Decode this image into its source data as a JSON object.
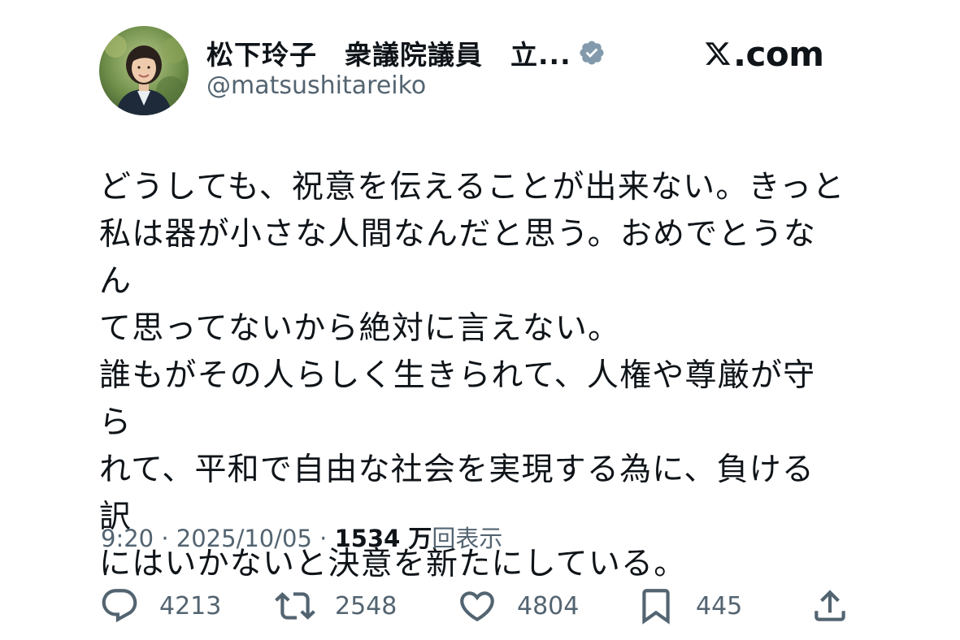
{
  "author": {
    "display_name": "松下玲子　衆議院議員　立...",
    "handle": "@matsushitareiko",
    "avatar_icon": "profile-photo",
    "verified_icon": "verified-badge-icon"
  },
  "brand": {
    "logo_icon": "x-logo-icon",
    "domain_text": ".com"
  },
  "tweet": {
    "text": "どうしても、祝意を伝えることが出来ない。きっと\n私は器が小さな人間なんだと思う。おめでとうなん\nて思ってないから絶対に言えない。\n誰もがその人らしく生きられて、人権や尊厳が守ら\nれて、平和で自由な社会を実現する為に、負ける訳\nにはいかないと決意を新たにしている。"
  },
  "meta": {
    "time": "9:20",
    "separator": "·",
    "date": "2025/10/05",
    "views_count": "1534 万",
    "views_label": "回表示"
  },
  "actions": {
    "replies": "4213",
    "reposts": "2548",
    "likes": "4804",
    "bookmarks": "445"
  },
  "colors": {
    "text_primary": "#0f1419",
    "text_secondary": "#536471",
    "verified_badge": "#829aab"
  }
}
